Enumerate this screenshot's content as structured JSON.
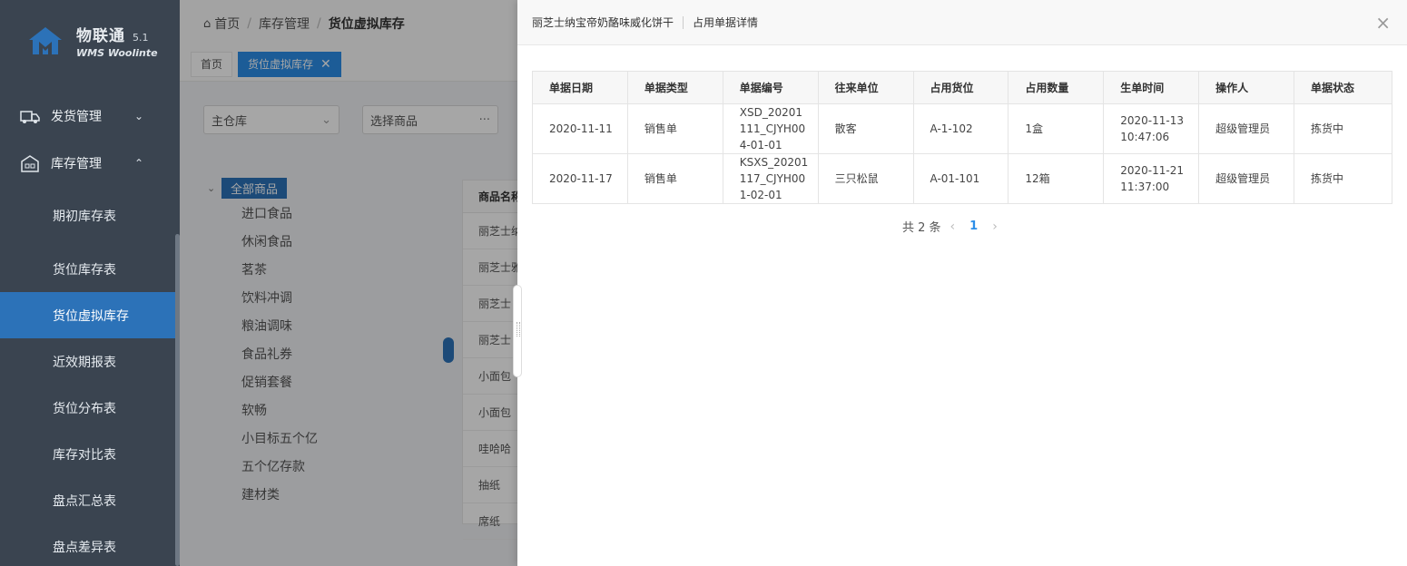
{
  "brand": {
    "name": "物联通",
    "version": "5.1",
    "subtitle": "WMS Woolinte"
  },
  "sidebar": {
    "groups": [
      {
        "label": "发货管理",
        "expanded": false
      },
      {
        "label": "库存管理",
        "expanded": true
      }
    ],
    "items": [
      {
        "label": "期初库存表"
      },
      {
        "label": "货位库存表"
      },
      {
        "label": "货位虚拟库存",
        "active": true
      },
      {
        "label": "近效期报表"
      },
      {
        "label": "货位分布表"
      },
      {
        "label": "库存对比表"
      },
      {
        "label": "盘点汇总表"
      },
      {
        "label": "盘点差异表"
      }
    ]
  },
  "breadcrumb": {
    "home": "首页",
    "section": "库存管理",
    "current": "货位虚拟库存"
  },
  "tabs": [
    {
      "label": "首页"
    },
    {
      "label": "货位虚拟库存",
      "active": true,
      "close": "✕"
    }
  ],
  "filters": {
    "warehouse": "主仓库",
    "product_placeholder": "选择商品",
    "more": "···"
  },
  "tree": {
    "root": "全部商品",
    "nodes": [
      "进口食品",
      "休闲食品",
      "茗茶",
      "饮料冲调",
      "粮油调味",
      "食品礼券",
      "促销套餐",
      "软畅",
      "小目标五个亿",
      "五个亿存款",
      "建材类"
    ]
  },
  "grid": {
    "header": "商品名称",
    "rows": [
      "丽芝士纳",
      "丽芝士雅",
      "丽芝士",
      "丽芝士",
      "小面包",
      "小面包",
      "哇哈哈",
      "抽纸",
      "席纸"
    ]
  },
  "drawer": {
    "product": "丽芝士纳宝帝奶酪味威化饼干",
    "title": "占用单据详情",
    "close": "×",
    "columns": [
      "单据日期",
      "单据类型",
      "单据编号",
      "往来单位",
      "占用货位",
      "占用数量",
      "生单时间",
      "操作人",
      "单据状态"
    ],
    "rows": [
      [
        "2020-11-11",
        "销售单",
        "XSD_20201111_CJYH004-01-01",
        "散客",
        "A-1-102",
        "1盒",
        "2020-11-13 10:47:06",
        "超级管理员",
        "拣货中"
      ],
      [
        "2020-11-17",
        "销售单",
        "KSXS_20201117_CJYH001-02-01",
        "三只松鼠",
        "A-01-101",
        "12箱",
        "2020-11-21 11:37:00",
        "超级管理员",
        "拣货中"
      ]
    ],
    "pagination": {
      "total": "共 2 条",
      "prev": "‹",
      "page": "1",
      "next": "›"
    }
  },
  "colors": {
    "accent": "#2c72b8",
    "sidebar_bg": "#3a4450",
    "link": "#2c8ee8"
  }
}
